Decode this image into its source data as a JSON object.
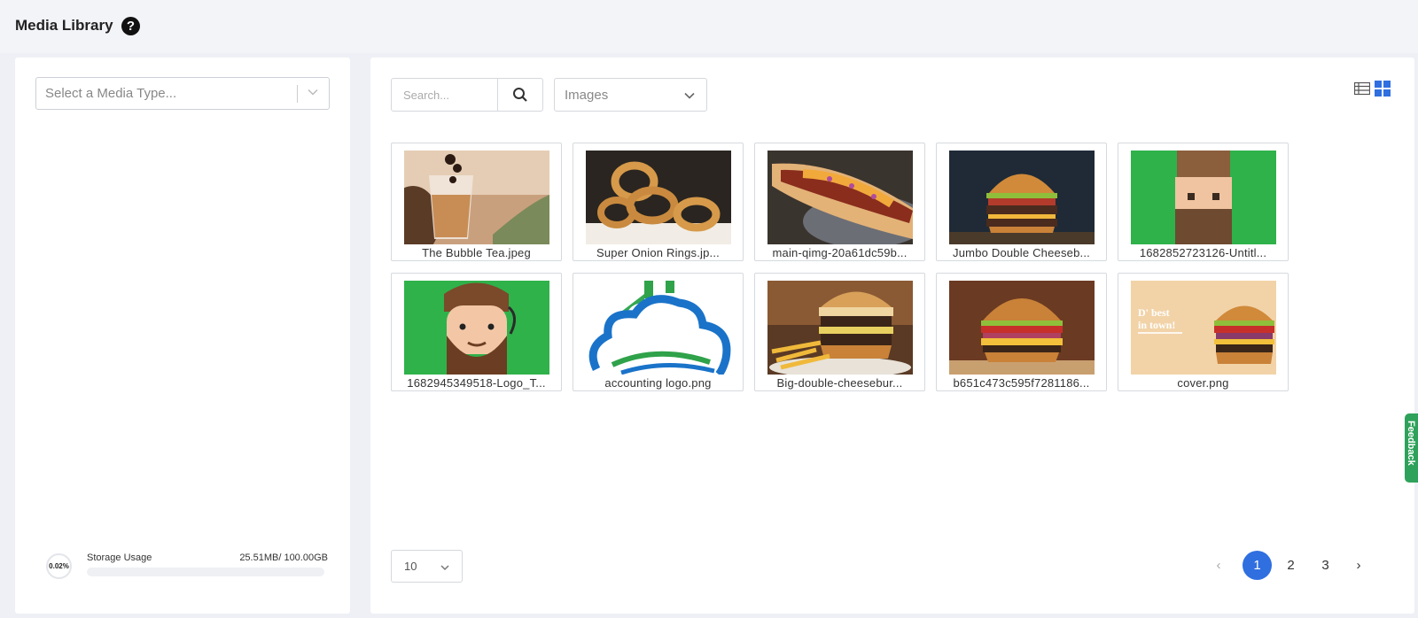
{
  "header": {
    "title": "Media Library",
    "help_icon": "question-circle-icon"
  },
  "left_panel": {
    "media_type_placeholder": "Select a Media Type...",
    "storage": {
      "percent_label": "0.02%",
      "label": "Storage Usage",
      "value": "25.51MB/ 100.00GB",
      "percent": 0.02
    }
  },
  "toolbar": {
    "search_placeholder": "Search...",
    "search_value": "",
    "filter_selected": "Images",
    "view_icons": [
      "list-view-icon",
      "grid-view-icon"
    ],
    "active_view": "grid"
  },
  "media": [
    {
      "name": "The Bubble Tea.jpeg"
    },
    {
      "name": "Super Onion Rings.jp..."
    },
    {
      "name": "main-qimg-20a61dc59b..."
    },
    {
      "name": "Jumbo Double Cheeseb..."
    },
    {
      "name": "1682852723126-Untitl..."
    },
    {
      "name": "1682945349518-Logo_T..."
    },
    {
      "name": "accounting logo.png"
    },
    {
      "name": "Big-double-cheesebur..."
    },
    {
      "name": "b651c473c595f7281186..."
    },
    {
      "name": "cover.png"
    }
  ],
  "cover_text": "D' best in town!",
  "pagination": {
    "page_size": "10",
    "prev": "‹",
    "next": "›",
    "pages": [
      "1",
      "2",
      "3"
    ],
    "current": "1"
  },
  "feedback_label": "Feedback",
  "colors": {
    "accent": "#2f6fe0",
    "feedback": "#2ea25a",
    "thumb_green": "#2fb24a"
  }
}
